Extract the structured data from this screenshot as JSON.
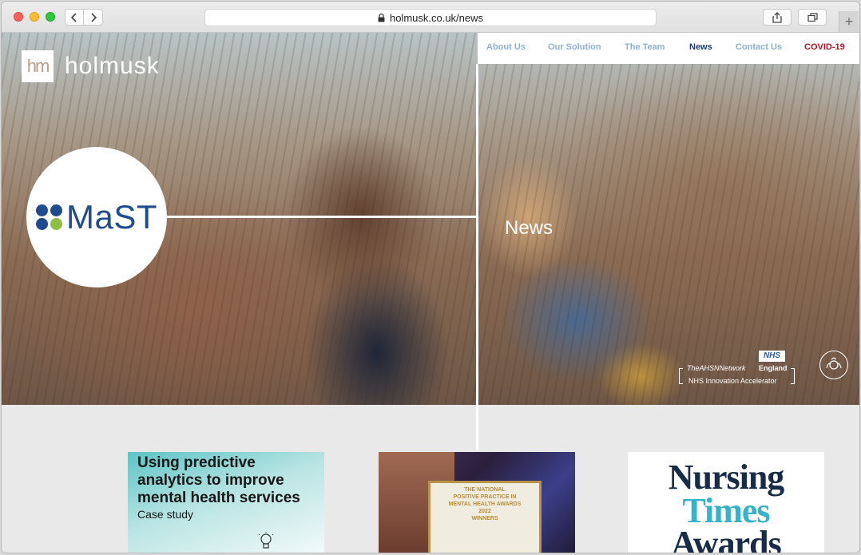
{
  "browser": {
    "url": "holmusk.co.uk/news",
    "new_tab_label": "+"
  },
  "site": {
    "logo_word": "holmusk",
    "logo_mark": "hm",
    "nav": [
      {
        "label": "About Us"
      },
      {
        "label": "Our Solution"
      },
      {
        "label": "The Team"
      },
      {
        "label": "News"
      },
      {
        "label": "Contact Us"
      },
      {
        "label": "COVID-19"
      }
    ],
    "product_logo": "MaST",
    "hero_title": "News",
    "badges": {
      "nhs": "NHS",
      "network": "TheAHSNNetwork",
      "england": "England",
      "accelerator": "NHS Innovation Accelerator"
    }
  },
  "cards": [
    {
      "headline": "Using predictive analytics to improve mental health services",
      "subtitle": "Case study"
    },
    {
      "certificate_lines": [
        "THE NATIONAL",
        "POSITIVE PRACTICE IN",
        "MENTAL HEALTH AWARDS",
        "2022",
        "WINNERS"
      ]
    },
    {
      "title_lines": [
        "Nursing",
        "Times",
        "Awards"
      ]
    }
  ],
  "colors": {
    "nav_inactive": "#8eb1cf",
    "nav_active": "#1d3b6a",
    "nav_covid": "#b0172a",
    "mast_blue": "#1f4c8f",
    "mast_green": "#8dbf43"
  }
}
